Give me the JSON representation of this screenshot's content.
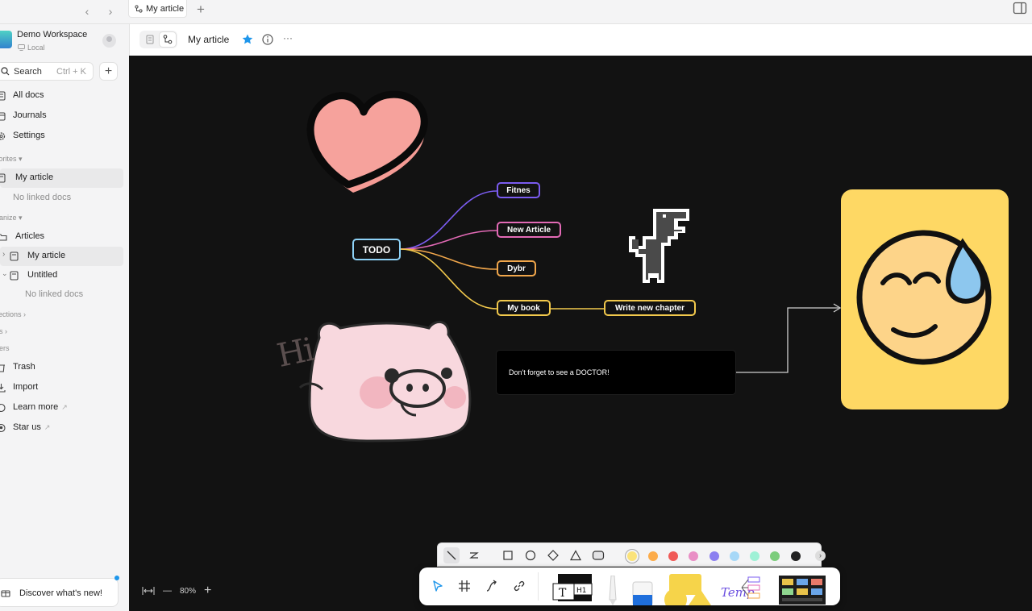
{
  "tab": {
    "label": "My article",
    "new_tab": "+"
  },
  "workspace": {
    "name": "Demo Workspace",
    "storage": "Local"
  },
  "search": {
    "placeholder": "Search",
    "shortcut": "Ctrl + K",
    "add": "+"
  },
  "nav": {
    "all_docs": "All docs",
    "journals": "Journals",
    "settings": "Settings"
  },
  "favorites": {
    "heading": "vorites",
    "item": "My article",
    "empty": "No linked docs"
  },
  "organize": {
    "heading": "ganize",
    "folder": "Articles",
    "doc1": "My article",
    "doc2": "Untitled",
    "empty": "No linked docs"
  },
  "collections": {
    "heading": "llections"
  },
  "tags": {
    "heading": "gs"
  },
  "others": {
    "heading": "hers",
    "trash": "Trash",
    "import": "Import",
    "learn_more": "Learn more",
    "star_us": "Star us"
  },
  "discover": {
    "label": "Discover what's new!"
  },
  "header": {
    "title": "My article",
    "more": "···"
  },
  "mindmap": {
    "root": "TODO",
    "children": [
      "Fitnes",
      "New Article",
      "Dybr",
      "My book"
    ],
    "grandchild": "Write new chapter"
  },
  "canvas": {
    "note": "Don't forget to see a DOCTOR!",
    "sticker_text": "Hi"
  },
  "zoom": {
    "level": "80%",
    "minus": "—",
    "plus": "+"
  },
  "palette": [
    "#fbe37b",
    "#fcac4a",
    "#f05a57",
    "#e98ec5",
    "#8b7ff0",
    "#a7d8f7",
    "#9ff1d6",
    "#7ccd7c",
    "#222222"
  ],
  "colors": {
    "accent": "#1e96eb",
    "canvas_bg": "#121212"
  }
}
